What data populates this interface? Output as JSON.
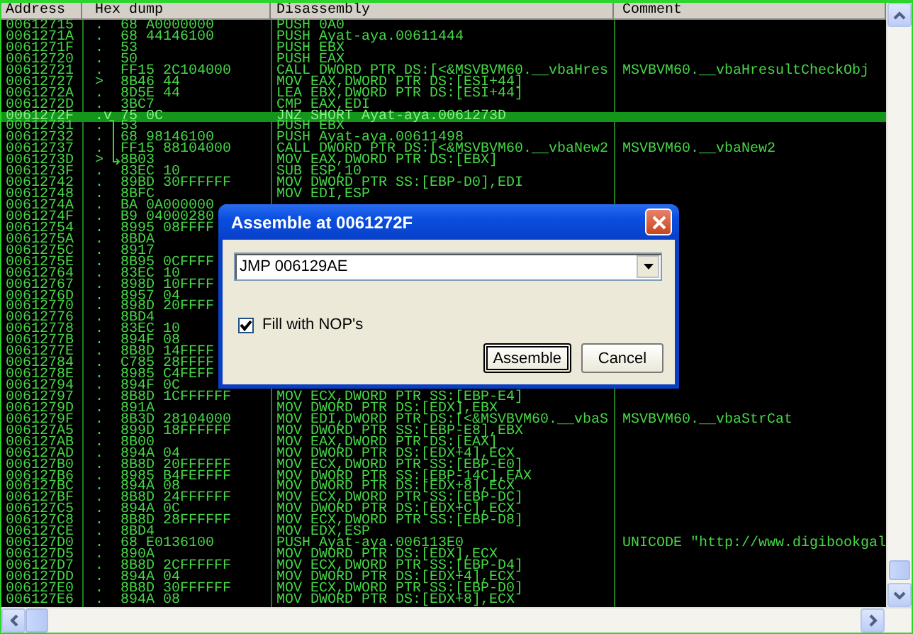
{
  "columns": [
    {
      "label": "Address"
    },
    {
      "label": "Hex dump"
    },
    {
      "label": "Disassembly"
    },
    {
      "label": "Comment"
    }
  ],
  "rows": [
    {
      "address": "00612715",
      "marker": ".",
      "hex": "68 A0000000",
      "disassembly": "PUSH 0A0",
      "selected": false
    },
    {
      "address": "0061271A",
      "marker": ".",
      "hex": "68 44146100",
      "disassembly": "PUSH Ayat-aya.00611444",
      "selected": false
    },
    {
      "address": "0061271F",
      "marker": ".",
      "hex": "53",
      "disassembly": "PUSH EBX",
      "selected": false
    },
    {
      "address": "00612720",
      "marker": ".",
      "hex": "50",
      "disassembly": "PUSH EAX",
      "selected": false
    },
    {
      "address": "00612721",
      "marker": ".",
      "hex": "FF15 2C104000",
      "disassembly": "CALL DWORD PTR DS:[<&MSVBVM60.__vbaHres",
      "comment": "MSVBVM60.__vbaHresultCheckObj",
      "selected": false
    },
    {
      "address": "00612727",
      "marker": ">",
      "hex": "8B46 44",
      "disassembly": "MOV EAX,DWORD PTR DS:[ESI+44]",
      "selected": false
    },
    {
      "address": "0061272A",
      "marker": ".",
      "hex": "8D5E 44",
      "disassembly": "LEA EBX,DWORD PTR DS:[ESI+44]",
      "selected": false
    },
    {
      "address": "0061272D",
      "marker": ".",
      "hex": "3BC7",
      "disassembly": "CMP EAX,EDI",
      "selected": false
    },
    {
      "address": "0061272F",
      "marker": ".v",
      "hex": "75 0C",
      "disassembly": "JNZ SHORT Ayat-aya.0061273D",
      "selected": true
    },
    {
      "address": "00612731",
      "marker": ".",
      "hex": "53",
      "disassembly": "PUSH EBX",
      "selected": false
    },
    {
      "address": "00612732",
      "marker": ".",
      "hex": "68 98146100",
      "disassembly": "PUSH Ayat-aya.00611498",
      "selected": false
    },
    {
      "address": "00612737",
      "marker": ".",
      "hex": "FF15 88104000",
      "disassembly": "CALL DWORD PTR DS:[<&MSVBVM60.__vbaNew2",
      "comment": "MSVBVM60.__vbaNew2",
      "selected": false
    },
    {
      "address": "0061273D",
      "marker": ">",
      "hex": "8B03",
      "disassembly": "MOV EAX,DWORD PTR DS:[EBX]",
      "selected": false
    },
    {
      "address": "0061273F",
      "marker": ".",
      "hex": "83EC 10",
      "disassembly": "SUB ESP,10",
      "selected": false
    },
    {
      "address": "00612742",
      "marker": ".",
      "hex": "89BD 30FFFFFF",
      "disassembly": "MOV DWORD PTR SS:[EBP-D0],EDI",
      "selected": false
    },
    {
      "address": "00612748",
      "marker": ".",
      "hex": "8BFC",
      "disassembly": "MOV EDI,ESP",
      "selected": false
    },
    {
      "address": "0061274A",
      "marker": ".",
      "hex": "BA 0A000000",
      "selected": false
    },
    {
      "address": "0061274F",
      "marker": ".",
      "hex": "B9 04000280",
      "selected": false
    },
    {
      "address": "00612754",
      "marker": ".",
      "hex": "8995 08FFFF",
      "selected": false
    },
    {
      "address": "0061275A",
      "marker": ".",
      "hex": "8BDA",
      "selected": false
    },
    {
      "address": "0061275C",
      "marker": ".",
      "hex": "8917",
      "selected": false
    },
    {
      "address": "0061275E",
      "marker": ".",
      "hex": "8B95 0CFFFF",
      "selected": false
    },
    {
      "address": "00612764",
      "marker": ".",
      "hex": "83EC 10",
      "selected": false
    },
    {
      "address": "00612767",
      "marker": ".",
      "hex": "898D 10FFFF",
      "selected": false
    },
    {
      "address": "0061276D",
      "marker": ".",
      "hex": "8957 04",
      "selected": false
    },
    {
      "address": "00612770",
      "marker": ".",
      "hex": "898D 20FFFF",
      "selected": false
    },
    {
      "address": "00612776",
      "marker": ".",
      "hex": "8BD4",
      "selected": false
    },
    {
      "address": "00612778",
      "marker": ".",
      "hex": "83EC 10",
      "selected": false
    },
    {
      "address": "0061277B",
      "marker": ".",
      "hex": "894F 08",
      "selected": false
    },
    {
      "address": "0061277E",
      "marker": ".",
      "hex": "8B8D 14FFFF",
      "selected": false
    },
    {
      "address": "00612784",
      "marker": ".",
      "hex": "C785 28FFFF",
      "selected": false
    },
    {
      "address": "0061278E",
      "marker": ".",
      "hex": "8985 C4FEFF",
      "selected": false
    },
    {
      "address": "00612794",
      "marker": ".",
      "hex": "894F 0C",
      "selected": false
    },
    {
      "address": "00612797",
      "marker": ".",
      "hex": "8B8D 1CFFFFFF",
      "disassembly": "MOV ECX,DWORD PTR SS:[EBP-E4]",
      "selected": false
    },
    {
      "address": "0061279D",
      "marker": ".",
      "hex": "891A",
      "disassembly": "MOV DWORD PTR DS:[EDX],EBX",
      "selected": false
    },
    {
      "address": "0061279F",
      "marker": ".",
      "hex": "8B3D 28104000",
      "disassembly": "MOV EDI,DWORD PTR DS:[<&MSVBVM60.__vbaS",
      "comment": "MSVBVM60.__vbaStrCat",
      "selected": false
    },
    {
      "address": "006127A5",
      "marker": ".",
      "hex": "899D 18FFFFFF",
      "disassembly": "MOV DWORD PTR SS:[EBP-E8],EBX",
      "selected": false
    },
    {
      "address": "006127AB",
      "marker": ".",
      "hex": "8B00",
      "disassembly": "MOV EAX,DWORD PTR DS:[EAX]",
      "selected": false
    },
    {
      "address": "006127AD",
      "marker": ".",
      "hex": "894A 04",
      "disassembly": "MOV DWORD PTR DS:[EDX+4],ECX",
      "selected": false
    },
    {
      "address": "006127B0",
      "marker": ".",
      "hex": "8B8D 20FFFFFF",
      "disassembly": "MOV ECX,DWORD PTR SS:[EBP-E0]",
      "selected": false
    },
    {
      "address": "006127B6",
      "marker": ".",
      "hex": "8985 B4FEFFFF",
      "disassembly": "MOV DWORD PTR SS:[EBP-14C],EAX",
      "selected": false
    },
    {
      "address": "006127BC",
      "marker": ".",
      "hex": "894A 08",
      "disassembly": "MOV DWORD PTR DS:[EDX+8],ECX",
      "selected": false
    },
    {
      "address": "006127BF",
      "marker": ".",
      "hex": "8B8D 24FFFFFF",
      "disassembly": "MOV ECX,DWORD PTR SS:[EBP-DC]",
      "selected": false
    },
    {
      "address": "006127C5",
      "marker": ".",
      "hex": "894A 0C",
      "disassembly": "MOV DWORD PTR DS:[EDX+C],ECX",
      "selected": false
    },
    {
      "address": "006127C8",
      "marker": ".",
      "hex": "8B8D 28FFFFFF",
      "disassembly": "MOV ECX,DWORD PTR SS:[EBP-D8]",
      "selected": false
    },
    {
      "address": "006127CE",
      "marker": ".",
      "hex": "8BD4",
      "disassembly": "MOV EDX,ESP",
      "selected": false
    },
    {
      "address": "006127D0",
      "marker": ".",
      "hex": "68 E0136100",
      "disassembly": "PUSH Ayat-aya.006113E0",
      "comment": "UNICODE \"http://www.digibookgal",
      "selected": false
    },
    {
      "address": "006127D5",
      "marker": ".",
      "hex": "890A",
      "disassembly": "MOV DWORD PTR DS:[EDX],ECX",
      "selected": false
    },
    {
      "address": "006127D7",
      "marker": ".",
      "hex": "8B8D 2CFFFFFF",
      "disassembly": "MOV ECX,DWORD PTR SS:[EBP-D4]",
      "selected": false
    },
    {
      "address": "006127DD",
      "marker": ".",
      "hex": "894A 04",
      "disassembly": "MOV DWORD PTR DS:[EDX+4],ECX",
      "selected": false
    },
    {
      "address": "006127E0",
      "marker": ".",
      "hex": "8B8D 30FFFFFF",
      "disassembly": "MOV ECX,DWORD PTR SS:[EBP-D0]",
      "selected": false
    },
    {
      "address": "006127E6",
      "marker": ".",
      "hex": "894A 08",
      "disassembly": "MOV DWORD PTR DS:[EDX+8],ECX",
      "selected": false
    }
  ],
  "dialog": {
    "title": "Assemble at 0061272F",
    "input": {
      "value": "JMP 006129AE"
    },
    "checkbox": {
      "label": "Fill with NOP's",
      "checked": true
    },
    "buttons": [
      {
        "label": "Assemble",
        "focused": true
      },
      {
        "label": "Cancel",
        "focused": false
      }
    ]
  }
}
